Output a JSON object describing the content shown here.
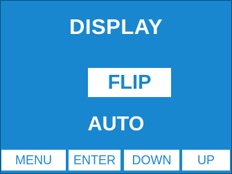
{
  "screen": {
    "title": "DISPLAY",
    "options": [
      {
        "label": "FLIP",
        "selected": true
      },
      {
        "label": "AUTO",
        "selected": false
      }
    ]
  },
  "softkeys": [
    {
      "label": "MENU"
    },
    {
      "label": "ENTER"
    },
    {
      "label": "DOWN"
    },
    {
      "label": "UP"
    }
  ],
  "colors": {
    "background": "#1887cf",
    "text": "#ffffff",
    "highlight_bg": "#ffffff",
    "highlight_text": "#1887cf"
  }
}
